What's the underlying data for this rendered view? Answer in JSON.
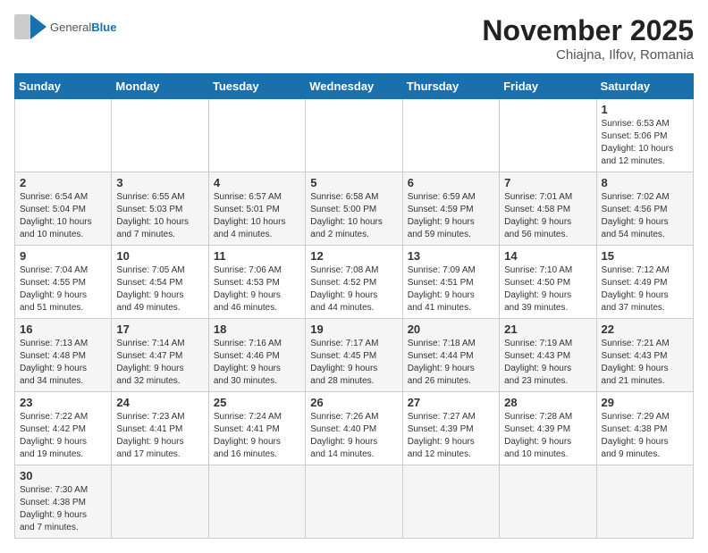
{
  "header": {
    "logo_general": "General",
    "logo_blue": "Blue",
    "month_title": "November 2025",
    "subtitle": "Chiajna, Ilfov, Romania"
  },
  "weekdays": [
    "Sunday",
    "Monday",
    "Tuesday",
    "Wednesday",
    "Thursday",
    "Friday",
    "Saturday"
  ],
  "weeks": [
    [
      {
        "day": "",
        "info": ""
      },
      {
        "day": "",
        "info": ""
      },
      {
        "day": "",
        "info": ""
      },
      {
        "day": "",
        "info": ""
      },
      {
        "day": "",
        "info": ""
      },
      {
        "day": "",
        "info": ""
      },
      {
        "day": "1",
        "info": "Sunrise: 6:53 AM\nSunset: 5:06 PM\nDaylight: 10 hours\nand 12 minutes."
      }
    ],
    [
      {
        "day": "2",
        "info": "Sunrise: 6:54 AM\nSunset: 5:04 PM\nDaylight: 10 hours\nand 10 minutes."
      },
      {
        "day": "3",
        "info": "Sunrise: 6:55 AM\nSunset: 5:03 PM\nDaylight: 10 hours\nand 7 minutes."
      },
      {
        "day": "4",
        "info": "Sunrise: 6:57 AM\nSunset: 5:01 PM\nDaylight: 10 hours\nand 4 minutes."
      },
      {
        "day": "5",
        "info": "Sunrise: 6:58 AM\nSunset: 5:00 PM\nDaylight: 10 hours\nand 2 minutes."
      },
      {
        "day": "6",
        "info": "Sunrise: 6:59 AM\nSunset: 4:59 PM\nDaylight: 9 hours\nand 59 minutes."
      },
      {
        "day": "7",
        "info": "Sunrise: 7:01 AM\nSunset: 4:58 PM\nDaylight: 9 hours\nand 56 minutes."
      },
      {
        "day": "8",
        "info": "Sunrise: 7:02 AM\nSunset: 4:56 PM\nDaylight: 9 hours\nand 54 minutes."
      }
    ],
    [
      {
        "day": "9",
        "info": "Sunrise: 7:04 AM\nSunset: 4:55 PM\nDaylight: 9 hours\nand 51 minutes."
      },
      {
        "day": "10",
        "info": "Sunrise: 7:05 AM\nSunset: 4:54 PM\nDaylight: 9 hours\nand 49 minutes."
      },
      {
        "day": "11",
        "info": "Sunrise: 7:06 AM\nSunset: 4:53 PM\nDaylight: 9 hours\nand 46 minutes."
      },
      {
        "day": "12",
        "info": "Sunrise: 7:08 AM\nSunset: 4:52 PM\nDaylight: 9 hours\nand 44 minutes."
      },
      {
        "day": "13",
        "info": "Sunrise: 7:09 AM\nSunset: 4:51 PM\nDaylight: 9 hours\nand 41 minutes."
      },
      {
        "day": "14",
        "info": "Sunrise: 7:10 AM\nSunset: 4:50 PM\nDaylight: 9 hours\nand 39 minutes."
      },
      {
        "day": "15",
        "info": "Sunrise: 7:12 AM\nSunset: 4:49 PM\nDaylight: 9 hours\nand 37 minutes."
      }
    ],
    [
      {
        "day": "16",
        "info": "Sunrise: 7:13 AM\nSunset: 4:48 PM\nDaylight: 9 hours\nand 34 minutes."
      },
      {
        "day": "17",
        "info": "Sunrise: 7:14 AM\nSunset: 4:47 PM\nDaylight: 9 hours\nand 32 minutes."
      },
      {
        "day": "18",
        "info": "Sunrise: 7:16 AM\nSunset: 4:46 PM\nDaylight: 9 hours\nand 30 minutes."
      },
      {
        "day": "19",
        "info": "Sunrise: 7:17 AM\nSunset: 4:45 PM\nDaylight: 9 hours\nand 28 minutes."
      },
      {
        "day": "20",
        "info": "Sunrise: 7:18 AM\nSunset: 4:44 PM\nDaylight: 9 hours\nand 26 minutes."
      },
      {
        "day": "21",
        "info": "Sunrise: 7:19 AM\nSunset: 4:43 PM\nDaylight: 9 hours\nand 23 minutes."
      },
      {
        "day": "22",
        "info": "Sunrise: 7:21 AM\nSunset: 4:43 PM\nDaylight: 9 hours\nand 21 minutes."
      }
    ],
    [
      {
        "day": "23",
        "info": "Sunrise: 7:22 AM\nSunset: 4:42 PM\nDaylight: 9 hours\nand 19 minutes."
      },
      {
        "day": "24",
        "info": "Sunrise: 7:23 AM\nSunset: 4:41 PM\nDaylight: 9 hours\nand 17 minutes."
      },
      {
        "day": "25",
        "info": "Sunrise: 7:24 AM\nSunset: 4:41 PM\nDaylight: 9 hours\nand 16 minutes."
      },
      {
        "day": "26",
        "info": "Sunrise: 7:26 AM\nSunset: 4:40 PM\nDaylight: 9 hours\nand 14 minutes."
      },
      {
        "day": "27",
        "info": "Sunrise: 7:27 AM\nSunset: 4:39 PM\nDaylight: 9 hours\nand 12 minutes."
      },
      {
        "day": "28",
        "info": "Sunrise: 7:28 AM\nSunset: 4:39 PM\nDaylight: 9 hours\nand 10 minutes."
      },
      {
        "day": "29",
        "info": "Sunrise: 7:29 AM\nSunset: 4:38 PM\nDaylight: 9 hours\nand 9 minutes."
      }
    ],
    [
      {
        "day": "30",
        "info": "Sunrise: 7:30 AM\nSunset: 4:38 PM\nDaylight: 9 hours\nand 7 minutes."
      },
      {
        "day": "",
        "info": ""
      },
      {
        "day": "",
        "info": ""
      },
      {
        "day": "",
        "info": ""
      },
      {
        "day": "",
        "info": ""
      },
      {
        "day": "",
        "info": ""
      },
      {
        "day": "",
        "info": ""
      }
    ]
  ]
}
